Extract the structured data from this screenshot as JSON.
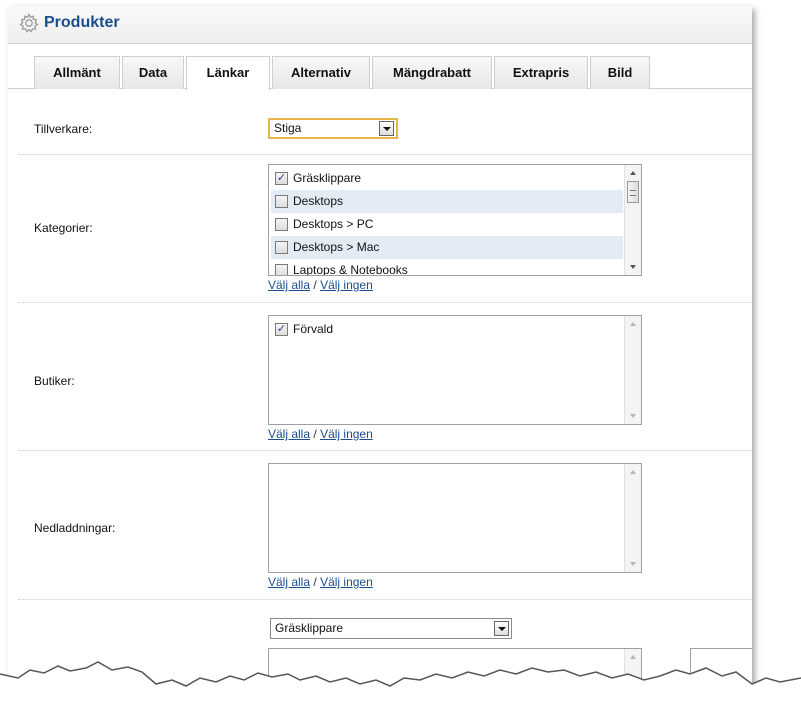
{
  "header": {
    "title": "Produkter"
  },
  "tabs": [
    {
      "label": "Allmänt"
    },
    {
      "label": "Data"
    },
    {
      "label": "Länkar"
    },
    {
      "label": "Alternativ"
    },
    {
      "label": "Mängdrabatt"
    },
    {
      "label": "Extrapris"
    },
    {
      "label": "Bild"
    }
  ],
  "active_tab": "Länkar",
  "manufacturer": {
    "label": "Tillverkare:",
    "value": "Stiga"
  },
  "categories": {
    "label": "Kategorier:",
    "items": [
      {
        "label": "Gräsklippare",
        "checked": true
      },
      {
        "label": "Desktops",
        "checked": false
      },
      {
        "label": "Desktops > PC",
        "checked": false
      },
      {
        "label": "Desktops > Mac",
        "checked": false
      },
      {
        "label": "Laptops & Notebooks",
        "checked": false
      }
    ]
  },
  "stores": {
    "label": "Butiker:",
    "items": [
      {
        "label": "Förvald",
        "checked": true
      }
    ]
  },
  "downloads": {
    "label": "Nedladdningar:",
    "items": []
  },
  "select_links": {
    "all": "Välj alla",
    "separator": "/",
    "none": "Välj ingen"
  },
  "related": {
    "dropdown_value": "Gräsklippare"
  },
  "icons": {
    "title_icon": "gear-icon",
    "check_mark": "✓"
  },
  "colors": {
    "title": "#1a4e8c",
    "link": "#1a4e8c",
    "alt_row": "#e3ecf5",
    "focus_border": "#e8b54a"
  }
}
